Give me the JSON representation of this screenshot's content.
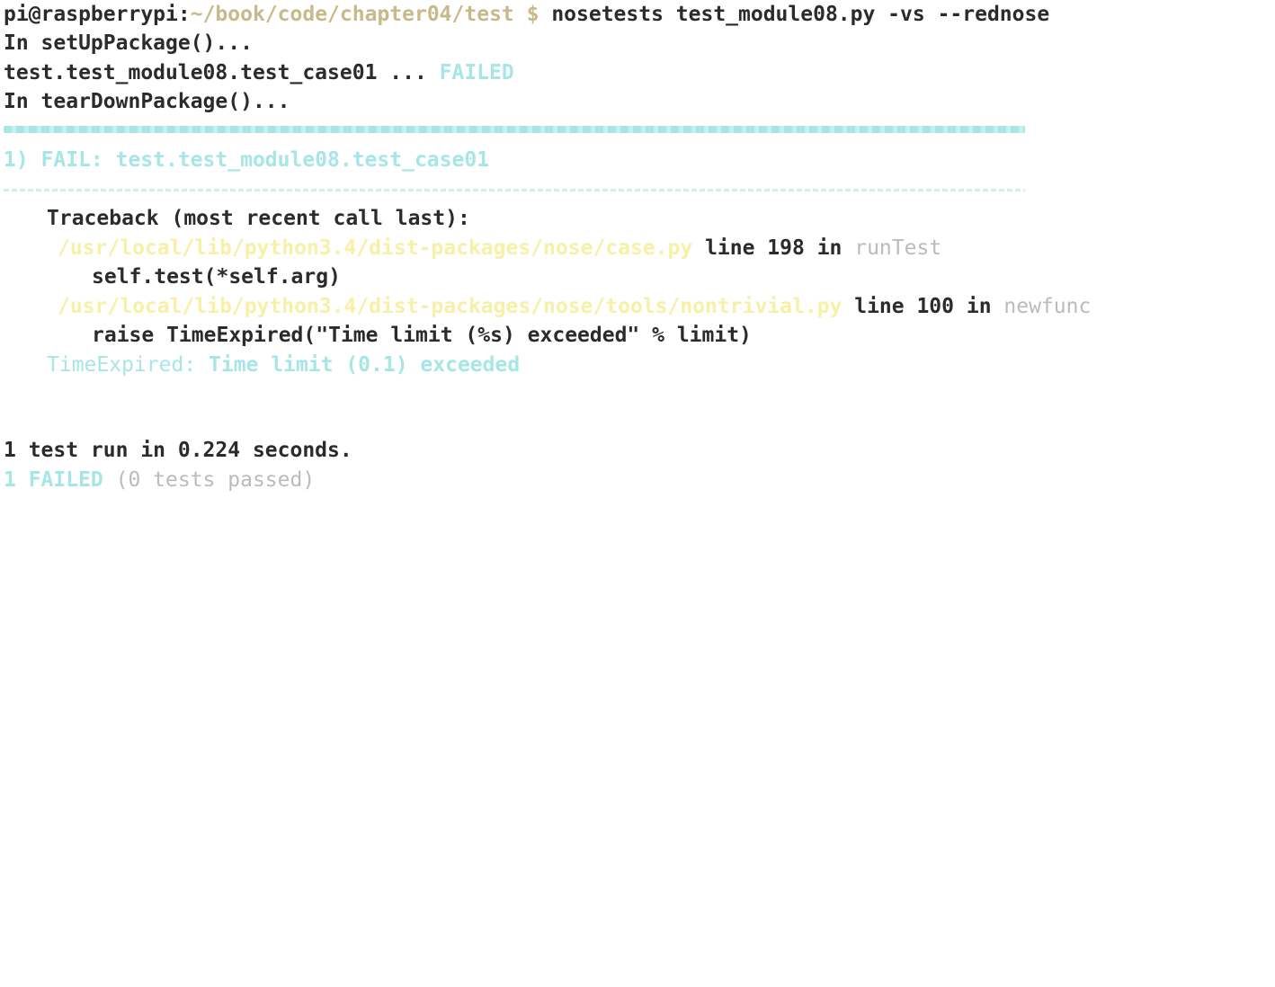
{
  "prompt": {
    "user_host": "pi@raspberrypi",
    "colon": ":",
    "path": "~/book/code/chapter04/test",
    "dollar": " $ ",
    "command": "nosetests test_module08.py -vs --rednose"
  },
  "output": {
    "setup": "In setUpPackage()...",
    "test_name": "test.test_module08.test_case01 ... ",
    "test_status": "FAILED",
    "teardown": "In tearDownPackage()..."
  },
  "failure": {
    "header": "1) FAIL: test.test_module08.test_case01",
    "traceback_title": "Traceback (most recent call last):",
    "frames": [
      {
        "file": "/usr/local/lib/python3.4/dist-packages/nose/case.py",
        "line_text": " line 198 in ",
        "func": "runTest",
        "code": "self.test(*self.arg)"
      },
      {
        "file": "/usr/local/lib/python3.4/dist-packages/nose/tools/nontrivial.py",
        "line_text": " line 100 in ",
        "func": "newfunc",
        "code": "raise TimeExpired(\"Time limit (%s) exceeded\" % limit)"
      }
    ],
    "exception_name": "TimeExpired:",
    "exception_message": " Time limit (0.1) exceeded"
  },
  "summary": {
    "run_line": "1 test run in 0.224 seconds.",
    "failed_count": "1 FAILED",
    "passed_note": " (0 tests passed)"
  },
  "colors": {
    "background": "#ffffff",
    "text": "#2b2b2b",
    "cyan": "#a6e6e6",
    "yellow": "#f7f0a6",
    "path": "#c8b98a"
  }
}
